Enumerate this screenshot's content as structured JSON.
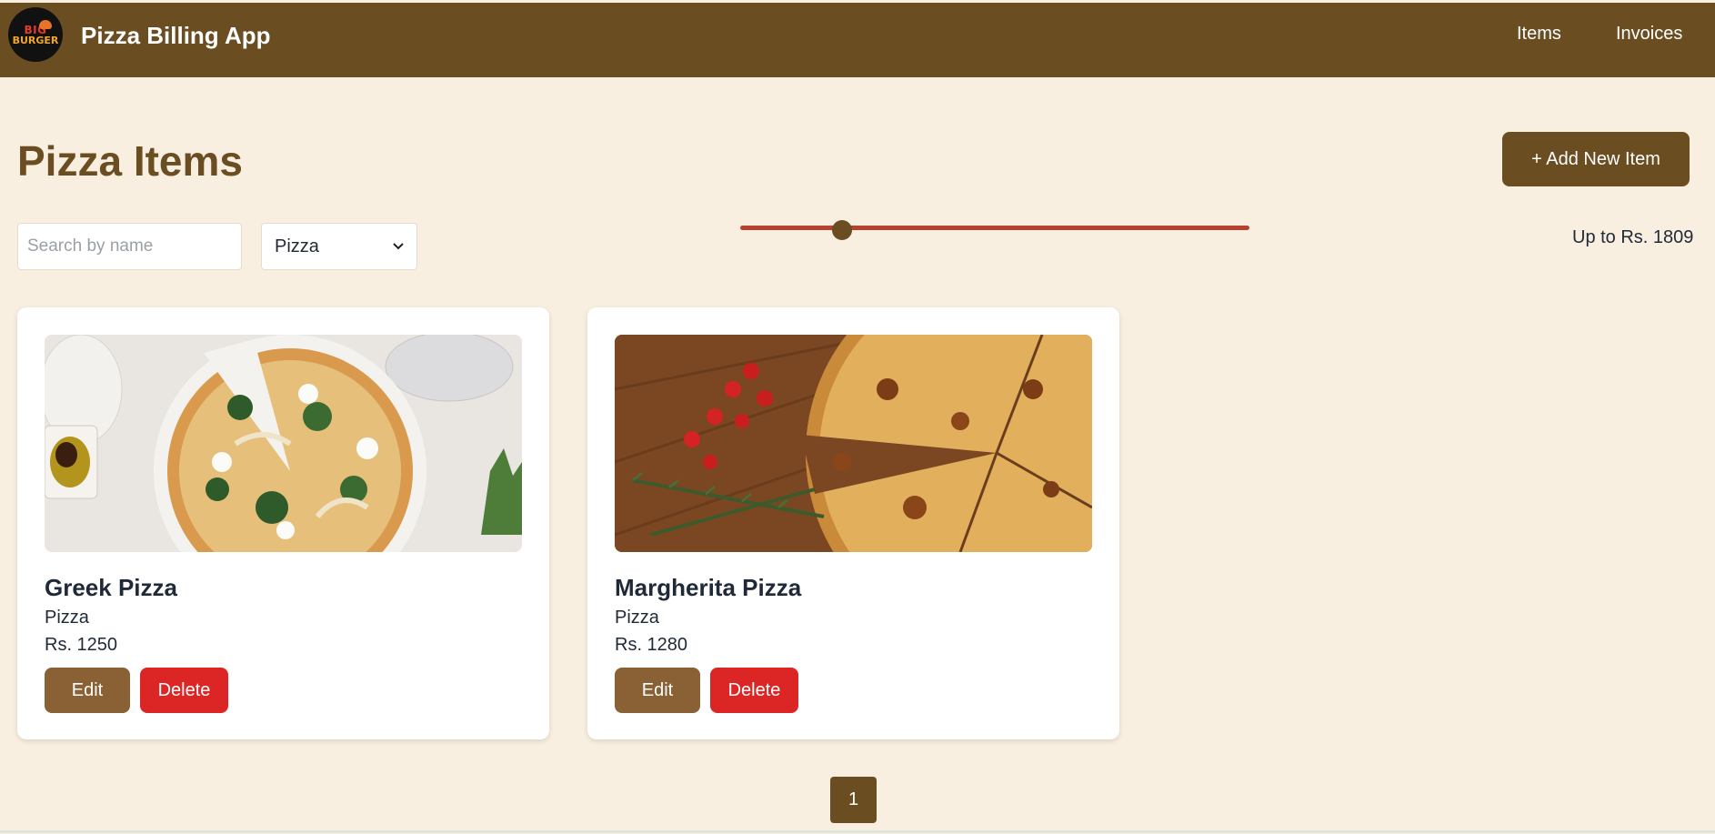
{
  "header": {
    "logo": {
      "text_line1": "BIG",
      "text_line2": "BURGER"
    },
    "title": "Pizza Billing App",
    "nav": [
      {
        "label": "Items"
      },
      {
        "label": "Invoices"
      }
    ],
    "background_color": "#6b4d22"
  },
  "main": {
    "title": "Pizza Items",
    "add_button_label": "+ Add New Item",
    "filters": {
      "search_placeholder": "Search by name",
      "search_value": "",
      "category_selected": "Pizza",
      "price_slider_fraction": 0.2,
      "price_label": "Up to Rs. 1809"
    },
    "items": [
      {
        "name": "Greek Pizza",
        "category": "Pizza",
        "price": "Rs. 1250",
        "edit_label": "Edit",
        "delete_label": "Delete",
        "image": "pizza-photo-greek"
      },
      {
        "name": "Margherita Pizza",
        "category": "Pizza",
        "price": "Rs. 1280",
        "edit_label": "Edit",
        "delete_label": "Delete",
        "image": "pizza-photo-margherita"
      }
    ],
    "pagination": {
      "current_page": "1"
    }
  },
  "colors": {
    "page_background": "#f8efe0",
    "accent_brown": "#6b4d22",
    "edit_button": "#8a6035",
    "delete_button": "#dc2626",
    "slider_track": "#b5412e"
  }
}
